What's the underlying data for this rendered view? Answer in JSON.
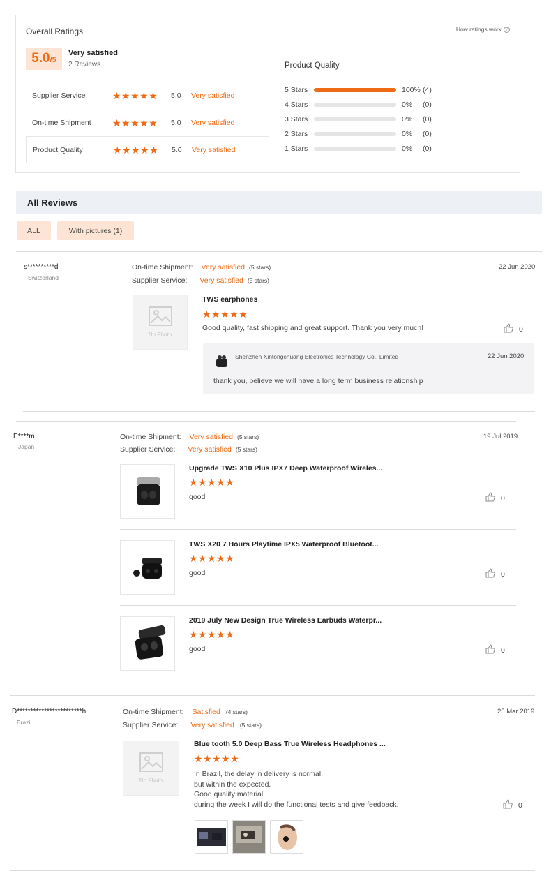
{
  "overall": {
    "title": "Overall Ratings",
    "how_link": "How ratings work",
    "score": "5.0",
    "score_denominator": "/5",
    "score_label": "Very satisfied",
    "review_count": "2 Reviews",
    "aspects": [
      {
        "name": "Supplier Service",
        "stars": "★★★★★",
        "value": "5.0",
        "word": "Very satisfied"
      },
      {
        "name": "On-time Shipment",
        "stars": "★★★★★",
        "value": "5.0",
        "word": "Very satisfied"
      },
      {
        "name": "Product Quality",
        "stars": "★★★★★",
        "value": "5.0",
        "word": "Very satisfied"
      }
    ],
    "quality": {
      "title": "Product Quality",
      "rows": [
        {
          "label": "5 Stars",
          "fraction": 1.0,
          "pct": "100%",
          "count": "(4)"
        },
        {
          "label": "4 Stars",
          "fraction": 0,
          "pct": "0%",
          "count": "(0)"
        },
        {
          "label": "3 Stars",
          "fraction": 0,
          "pct": "0%",
          "count": "(0)"
        },
        {
          "label": "2 Stars",
          "fraction": 0,
          "pct": "0%",
          "count": "(0)"
        },
        {
          "label": "1 Stars",
          "fraction": 0,
          "pct": "0%",
          "count": "(0)"
        }
      ]
    }
  },
  "reviews_section": {
    "title": "All Reviews",
    "filters": [
      "ALL",
      "With pictures (1)"
    ]
  },
  "reviews": [
    {
      "user": "s**********d",
      "country": "Switzerland",
      "date": "22 Jun 2020",
      "shipment_label": "On-time Shipment:",
      "shipment_value": "Very satisfied",
      "shipment_stars": "(5 stars)",
      "service_label": "Supplier Service:",
      "service_value": "Very satisfied",
      "service_stars": "(5 stars)",
      "items": [
        {
          "title": "TWS earphones",
          "stars": "★★★★★",
          "text": "Good quality, fast shipping and great support. Thank you very much!",
          "likes": "0",
          "image": "No Photo"
        }
      ],
      "reply": {
        "company": "Shenzhen Xintongchuang Electronics Technology Co., Limited",
        "date": "22 Jun 2020",
        "text": "thank you, believe we will have a long term business relationship"
      }
    },
    {
      "user": "E****m",
      "country": "Japan",
      "date": "19 Jul 2019",
      "shipment_label": "On-time Shipment:",
      "shipment_value": "Very satisfied",
      "shipment_stars": "(5 stars)",
      "service_label": "Supplier Service:",
      "service_value": "Very satisfied",
      "service_stars": "(5 stars)",
      "items": [
        {
          "title": "Upgrade TWS X10 Plus IPX7 Deep Waterproof Wireles...",
          "stars": "★★★★★",
          "text": "good",
          "likes": "0"
        },
        {
          "title": "TWS X20 7 Hours Playtime IPX5 Waterproof Bluetoot...",
          "stars": "★★★★★",
          "text": "good",
          "likes": "0"
        },
        {
          "title": "2019 July New Design True Wireless Earbuds Waterpr...",
          "stars": "★★★★★",
          "text": "good",
          "likes": "0"
        }
      ]
    },
    {
      "user": "D************************h",
      "country": "Brazil",
      "date": "25 Mar 2019",
      "shipment_label": "On-time Shipment:",
      "shipment_value": "Satisfied",
      "shipment_stars": "(4 stars)",
      "service_label": "Supplier Service:",
      "service_value": "Very satisfied",
      "service_stars": "(5 stars)",
      "items": [
        {
          "title": "Blue tooth 5.0 Deep Bass True Wireless Headphones ...",
          "stars": "★★★★★",
          "text_lines": [
            "In Brazil, the delay in delivery is normal.",
            "but within the expected.",
            "Good quality material.",
            "during the week I will do the functional tests and give feedback."
          ],
          "likes": "0",
          "image": "No Photo"
        }
      ]
    }
  ],
  "colors": {
    "accent": "#ee6a14",
    "accent_light": "#fde4d4",
    "header_bg": "#edf0f4"
  }
}
